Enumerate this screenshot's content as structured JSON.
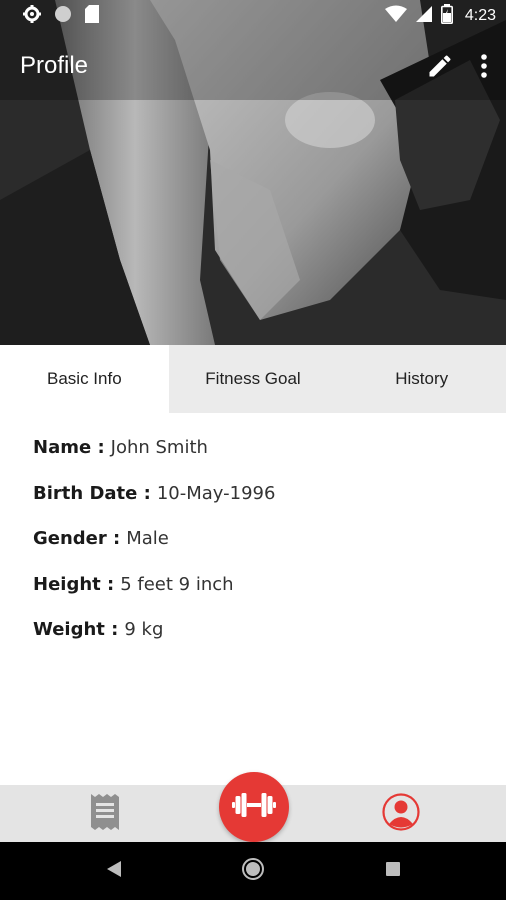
{
  "status_bar": {
    "time": "4:23",
    "left_icons": [
      "settings-icon",
      "circle-icon",
      "sd-card-icon"
    ],
    "right_icons": [
      "wifi-icon",
      "cell-signal-icon",
      "battery-icon"
    ]
  },
  "app_bar": {
    "title": "Profile",
    "actions": [
      "edit-icon",
      "more-vert-icon"
    ]
  },
  "tabs": [
    {
      "label": "Basic Info",
      "active": true
    },
    {
      "label": "Fitness Goal",
      "active": false
    },
    {
      "label": "History",
      "active": false
    }
  ],
  "basic_info": [
    {
      "label": "Name :",
      "value": "John Smith"
    },
    {
      "label": "Birth Date :",
      "value": "10-May-1996"
    },
    {
      "label": "Gender :",
      "value": "Male"
    },
    {
      "label": "Height :",
      "value": "5 feet 9 inch"
    },
    {
      "label": "Weight :",
      "value": "9 kg"
    }
  ],
  "bottom_nav": {
    "items": [
      "receipt-icon",
      "dumbbell-icon",
      "profile-icon"
    ],
    "accent_color": "#e53935"
  },
  "system_nav": [
    "back-icon",
    "home-icon",
    "recents-icon"
  ]
}
